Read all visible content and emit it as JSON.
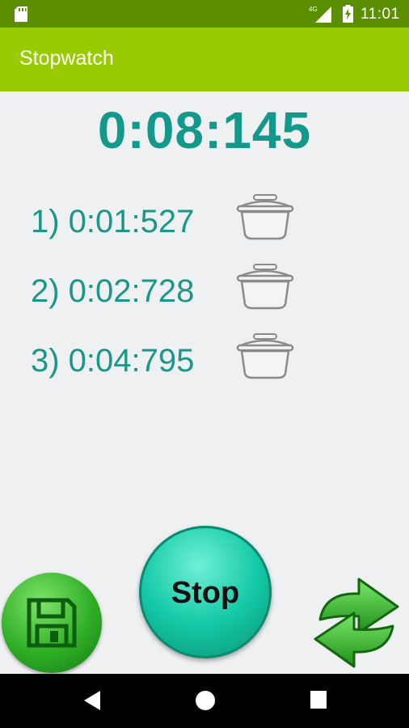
{
  "status_bar": {
    "time": "11:01",
    "network": "4G",
    "icons": [
      "sd-card-icon",
      "signal-icon",
      "battery-icon"
    ]
  },
  "app_bar": {
    "title": "Stopwatch",
    "color": "#99cc00"
  },
  "timer": {
    "elapsed": "0:08:145",
    "color": "#12998b"
  },
  "laps": [
    {
      "label": "1) 0:01:527",
      "action_icon": "trash-icon"
    },
    {
      "label": "2) 0:02:728",
      "action_icon": "trash-icon"
    },
    {
      "label": "3) 0:04:795",
      "action_icon": "trash-icon"
    }
  ],
  "controls": {
    "save_icon": "floppy-disk-icon",
    "stop_label": "Stop",
    "reset_icon": "refresh-arrows-icon"
  },
  "nav_bar": {
    "icons": [
      "back-icon",
      "home-icon",
      "recents-icon"
    ]
  }
}
